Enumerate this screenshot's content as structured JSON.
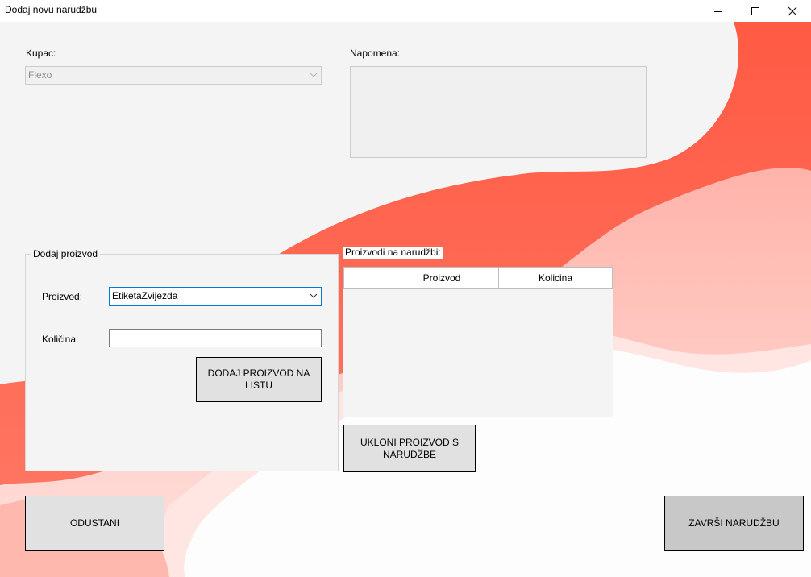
{
  "window": {
    "title": "Dodaj novu narudžbu",
    "minimize_icon": "minimize-icon",
    "maximize_icon": "maximize-icon",
    "close_icon": "close-icon"
  },
  "customer": {
    "label": "Kupac:",
    "value": "Flexo"
  },
  "note": {
    "label": "Napomena:",
    "value": ""
  },
  "add_product": {
    "group_title": "Dodaj proizvod",
    "product_label": "Proizvod:",
    "product_value": "EtiketaZvijezda",
    "quantity_label": "Količina:",
    "quantity_value": "",
    "add_button": "DODAJ PROIZVOD NA LISTU"
  },
  "order_list": {
    "label": "Proizvodi na narudžbi:",
    "columns": [
      "",
      "Proizvod",
      "Kolicina"
    ],
    "rows": []
  },
  "remove_button": "UKLONI PROIZVOD S NARUDŽBE",
  "cancel_button": "ODUSTANI",
  "finish_button": "ZAVRŠI NARUDŽBU",
  "colors": {
    "accent_red": "#ff6a55",
    "light_red": "#ffaaa0",
    "background": "#f4f4f4"
  }
}
